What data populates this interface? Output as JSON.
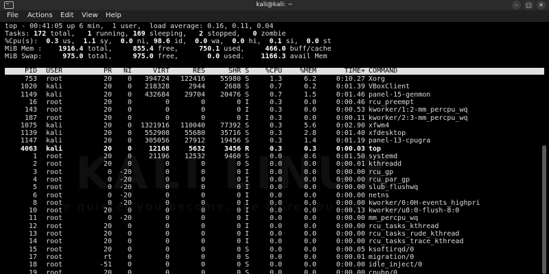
{
  "window": {
    "title": "kali@kali: ~",
    "menu": [
      "File",
      "Actions",
      "Edit",
      "View",
      "Help"
    ],
    "buttons": [
      "–",
      "□",
      "✕"
    ]
  },
  "watermark": {
    "logo_text": "KALI LINUX",
    "tagline": "the quieter you become, the more you are able to hear"
  },
  "summary": {
    "line1": "top - 00:41:05 up 6 min,  1 user,  load average: 0.16, 0.11, 0.04",
    "tasks": {
      "label": "Tasks:",
      "total": "172",
      "total_lbl": "total,",
      "running": "1",
      "running_lbl": "running,",
      "sleeping": "169",
      "sleeping_lbl": "sleeping,",
      "stopped": "2",
      "stopped_lbl": "stopped,",
      "zombie": "0",
      "zombie_lbl": "zombie"
    },
    "cpu": {
      "label": "%Cpu(s):",
      "us": "0.3",
      "us_lbl": "us,",
      "sy": "1.1",
      "sy_lbl": "sy,",
      "ni": "0.0",
      "ni_lbl": "ni,",
      "id": "98.6",
      "id_lbl": "id,",
      "wa": "0.0",
      "wa_lbl": "wa,",
      "hi": "0.0",
      "hi_lbl": "hi,",
      "si": "0.1",
      "si_lbl": "si,",
      "st": "0.0",
      "st_lbl": "st"
    },
    "mem": {
      "label": "MiB Mem :",
      "total": "1916.4",
      "total_lbl": "total,",
      "free": "855.4",
      "free_lbl": "free,",
      "used": "750.1",
      "used_lbl": "used,",
      "buff": "466.0",
      "buff_lbl": "buff/cache"
    },
    "swap": {
      "label": "MiB Swap:",
      "total": "975.0",
      "total_lbl": "total,",
      "free": "975.0",
      "free_lbl": "free,",
      "used": "0.0",
      "used_lbl": "used.",
      "avail": "1166.3",
      "avail_lbl": "avail Mem"
    }
  },
  "table": {
    "headers": [
      "PID",
      "USER",
      "PR",
      "NI",
      "VIRT",
      "RES",
      "SHR",
      "S",
      "%CPU",
      "%MEM",
      "TIME+",
      "COMMAND"
    ],
    "rows": [
      [
        "753",
        "root",
        "20",
        "0",
        "394724",
        "122416",
        "55980",
        "S",
        "1.3",
        "6.2",
        "0:10.27",
        "Xorg"
      ],
      [
        "1020",
        "kali",
        "20",
        "0",
        "218328",
        "2944",
        "2688",
        "S",
        "0.7",
        "0.2",
        "0:01.39",
        "VBoxClient"
      ],
      [
        "1149",
        "kali",
        "20",
        "0",
        "432684",
        "29704",
        "20476",
        "S",
        "0.7",
        "1.5",
        "0:01.46",
        "panel-15-genmon"
      ],
      [
        "16",
        "root",
        "20",
        "0",
        "0",
        "0",
        "0",
        "I",
        "0.3",
        "0.0",
        "0:00.46",
        "rcu_preempt"
      ],
      [
        "143",
        "root",
        "20",
        "0",
        "0",
        "0",
        "0",
        "I",
        "0.3",
        "0.0",
        "0:00.53",
        "kworker/1:2-mm_percpu_wq"
      ],
      [
        "187",
        "root",
        "20",
        "0",
        "0",
        "0",
        "0",
        "I",
        "0.3",
        "0.0",
        "0:00.11",
        "kworker/2:3-mm_percpu_wq"
      ],
      [
        "1075",
        "kali",
        "20",
        "0",
        "1321916",
        "110040",
        "77392",
        "S",
        "0.3",
        "5.6",
        "0:02.90",
        "xfwm4"
      ],
      [
        "1139",
        "kali",
        "20",
        "0",
        "552908",
        "55680",
        "35716",
        "S",
        "0.3",
        "2.8",
        "0:01.40",
        "xfdesktop"
      ],
      [
        "1147",
        "kali",
        "20",
        "0",
        "305056",
        "27912",
        "19456",
        "S",
        "0.3",
        "1.4",
        "0:01.19",
        "panel-13-cpugra"
      ],
      [
        "4063",
        "kali",
        "20",
        "0",
        "12168",
        "5632",
        "3456",
        "R",
        "0.3",
        "0.3",
        "0:00.03",
        "top"
      ],
      [
        "1",
        "root",
        "20",
        "0",
        "21196",
        "12532",
        "9460",
        "S",
        "0.0",
        "0.6",
        "0:01.50",
        "systemd"
      ],
      [
        "2",
        "root",
        "20",
        "0",
        "0",
        "0",
        "0",
        "S",
        "0.0",
        "0.0",
        "0:00.01",
        "kthreadd"
      ],
      [
        "3",
        "root",
        "0",
        "-20",
        "0",
        "0",
        "0",
        "I",
        "0.0",
        "0.0",
        "0:00.00",
        "rcu_gp"
      ],
      [
        "4",
        "root",
        "0",
        "-20",
        "0",
        "0",
        "0",
        "I",
        "0.0",
        "0.0",
        "0:00.00",
        "rcu_par_gp"
      ],
      [
        "5",
        "root",
        "0",
        "-20",
        "0",
        "0",
        "0",
        "I",
        "0.0",
        "0.0",
        "0:00.00",
        "slub_flushwq"
      ],
      [
        "6",
        "root",
        "0",
        "-20",
        "0",
        "0",
        "0",
        "I",
        "0.0",
        "0.0",
        "0:00.00",
        "netns"
      ],
      [
        "8",
        "root",
        "0",
        "-20",
        "0",
        "0",
        "0",
        "I",
        "0.0",
        "0.0",
        "0:00.00",
        "kworker/0:0H-events_highpri"
      ],
      [
        "10",
        "root",
        "20",
        "0",
        "0",
        "0",
        "0",
        "I",
        "0.0",
        "0.0",
        "0:00.13",
        "kworker/u8:0-flush-8:0"
      ],
      [
        "11",
        "root",
        "0",
        "-20",
        "0",
        "0",
        "0",
        "I",
        "0.0",
        "0.0",
        "0:00.00",
        "mm_percpu_wq"
      ],
      [
        "12",
        "root",
        "20",
        "0",
        "0",
        "0",
        "0",
        "I",
        "0.0",
        "0.0",
        "0:00.00",
        "rcu_tasks_kthread"
      ],
      [
        "13",
        "root",
        "20",
        "0",
        "0",
        "0",
        "0",
        "I",
        "0.0",
        "0.0",
        "0:00.00",
        "rcu_tasks_rude_kthread"
      ],
      [
        "14",
        "root",
        "20",
        "0",
        "0",
        "0",
        "0",
        "I",
        "0.0",
        "0.0",
        "0:00.00",
        "rcu_tasks_trace_kthread"
      ],
      [
        "15",
        "root",
        "20",
        "0",
        "0",
        "0",
        "0",
        "S",
        "0.0",
        "0.0",
        "0:00.05",
        "ksoftirqd/0"
      ],
      [
        "17",
        "root",
        "rt",
        "0",
        "0",
        "0",
        "0",
        "S",
        "0.0",
        "0.0",
        "0:00.01",
        "migration/0"
      ],
      [
        "18",
        "root",
        "-51",
        "0",
        "0",
        "0",
        "0",
        "S",
        "0.0",
        "0.0",
        "0:00.00",
        "idle_inject/0"
      ],
      [
        "19",
        "root",
        "20",
        "0",
        "0",
        "0",
        "0",
        "S",
        "0.0",
        "0.0",
        "0:00.00",
        "cpuhp/0"
      ]
    ],
    "highlighted_row_pid": "4063"
  },
  "colors": {
    "background": "#000000",
    "text": "#dedede",
    "header_bg": "#e0e0e0",
    "titlebar_bg": "#2b2b2b",
    "menubar_bg": "#202020"
  }
}
